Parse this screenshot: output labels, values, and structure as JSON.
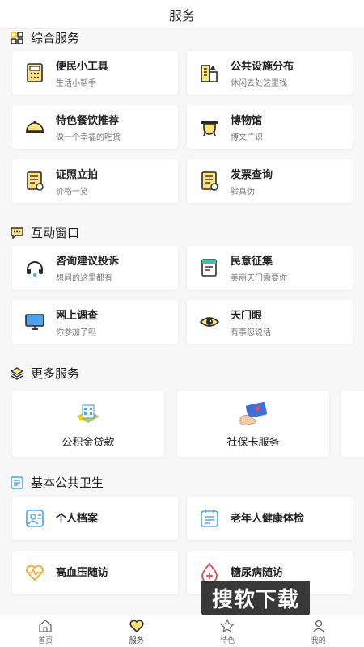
{
  "header": {
    "title": "服务"
  },
  "sections": {
    "comprehensive": {
      "title": "综合服务",
      "cards": [
        {
          "title": "便民小工具",
          "subtitle": "生活小帮手"
        },
        {
          "title": "公共设施分布",
          "subtitle": "休闲去处这里找"
        },
        {
          "title": "特色餐饮推荐",
          "subtitle": "做一个幸福的吃货"
        },
        {
          "title": "博物馆",
          "subtitle": "博文广识"
        },
        {
          "title": "证照立拍",
          "subtitle": "价格一览"
        },
        {
          "title": "发票查询",
          "subtitle": "验真伪"
        }
      ]
    },
    "interactive": {
      "title": "互动窗口",
      "cards": [
        {
          "title": "咨询建议投诉",
          "subtitle": "想问的这里都有"
        },
        {
          "title": "民意征集",
          "subtitle": "美丽天门需要你"
        },
        {
          "title": "网上调查",
          "subtitle": "你参加了吗"
        },
        {
          "title": "天门眼",
          "subtitle": "有事您说话"
        }
      ]
    },
    "more": {
      "title": "更多服务",
      "cards": [
        {
          "label": "公积金贷款"
        },
        {
          "label": "社保卡服务"
        }
      ]
    },
    "health": {
      "title": "基本公共卫生",
      "cards": [
        {
          "title": "个人档案"
        },
        {
          "title": "老年人健康体检"
        },
        {
          "title": "高血压随访"
        },
        {
          "title": "糖尿病随访"
        }
      ]
    }
  },
  "tabbar": {
    "items": [
      {
        "label": "首页"
      },
      {
        "label": "服务"
      },
      {
        "label": "特色"
      },
      {
        "label": "我的"
      }
    ]
  },
  "watermark": "搜软下载",
  "colors": {
    "accent_yellow": "#f5c518",
    "dark": "#2b2b2b",
    "health_blue": "#4aa3f0"
  }
}
